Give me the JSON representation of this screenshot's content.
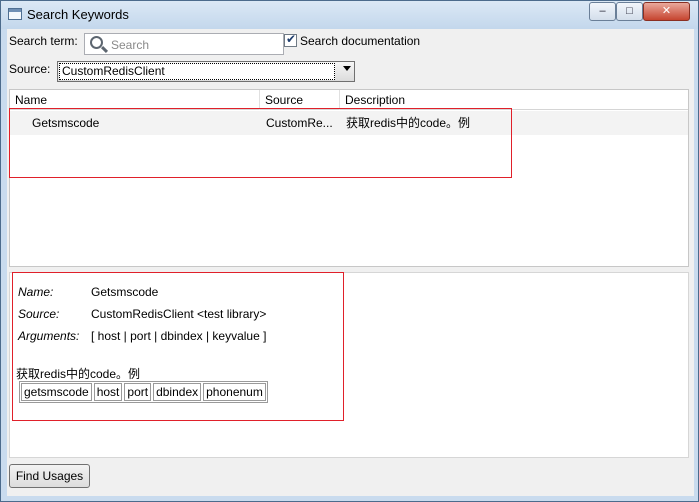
{
  "window": {
    "title": "Search Keywords",
    "minimize_glyph": "–",
    "maximize_glyph": "□",
    "close_glyph": "✕"
  },
  "search": {
    "label": "Search term:",
    "placeholder": "Search",
    "value": "",
    "search_documentation_label": "Search documentation",
    "search_documentation_checked": true,
    "check_glyph": "✔"
  },
  "source": {
    "label": "Source:",
    "selected": "CustomRedisClient"
  },
  "keyword_list": {
    "columns": [
      "Name",
      "Source",
      "Description"
    ],
    "rows": [
      {
        "name": "Getsmscode",
        "source": "CustomRe...",
        "description": "获取redis中的code。例"
      }
    ]
  },
  "details": {
    "name_label": "Name:",
    "name_value": "Getsmscode",
    "source_label": "Source:",
    "source_value": "CustomRedisClient <test library>",
    "arguments_label": "Arguments:",
    "arguments_value": "[ host | port | dbindex | keyvalue ]",
    "documentation": "获取redis中的code。例",
    "example_cells": [
      "getsmscode",
      "host",
      "port",
      "dbindex",
      "phonenum"
    ]
  },
  "footer": {
    "find_usages_label": "Find Usages"
  },
  "colors": {
    "annotation_red": "#e0202a",
    "title_bar": "#c9dbee",
    "selected_row": "#f3f3f3"
  },
  "icons": {
    "window_icon": "app-window-icon",
    "search_icon": "magnifier-icon",
    "dropdown_icon": "chevron-down-icon"
  }
}
